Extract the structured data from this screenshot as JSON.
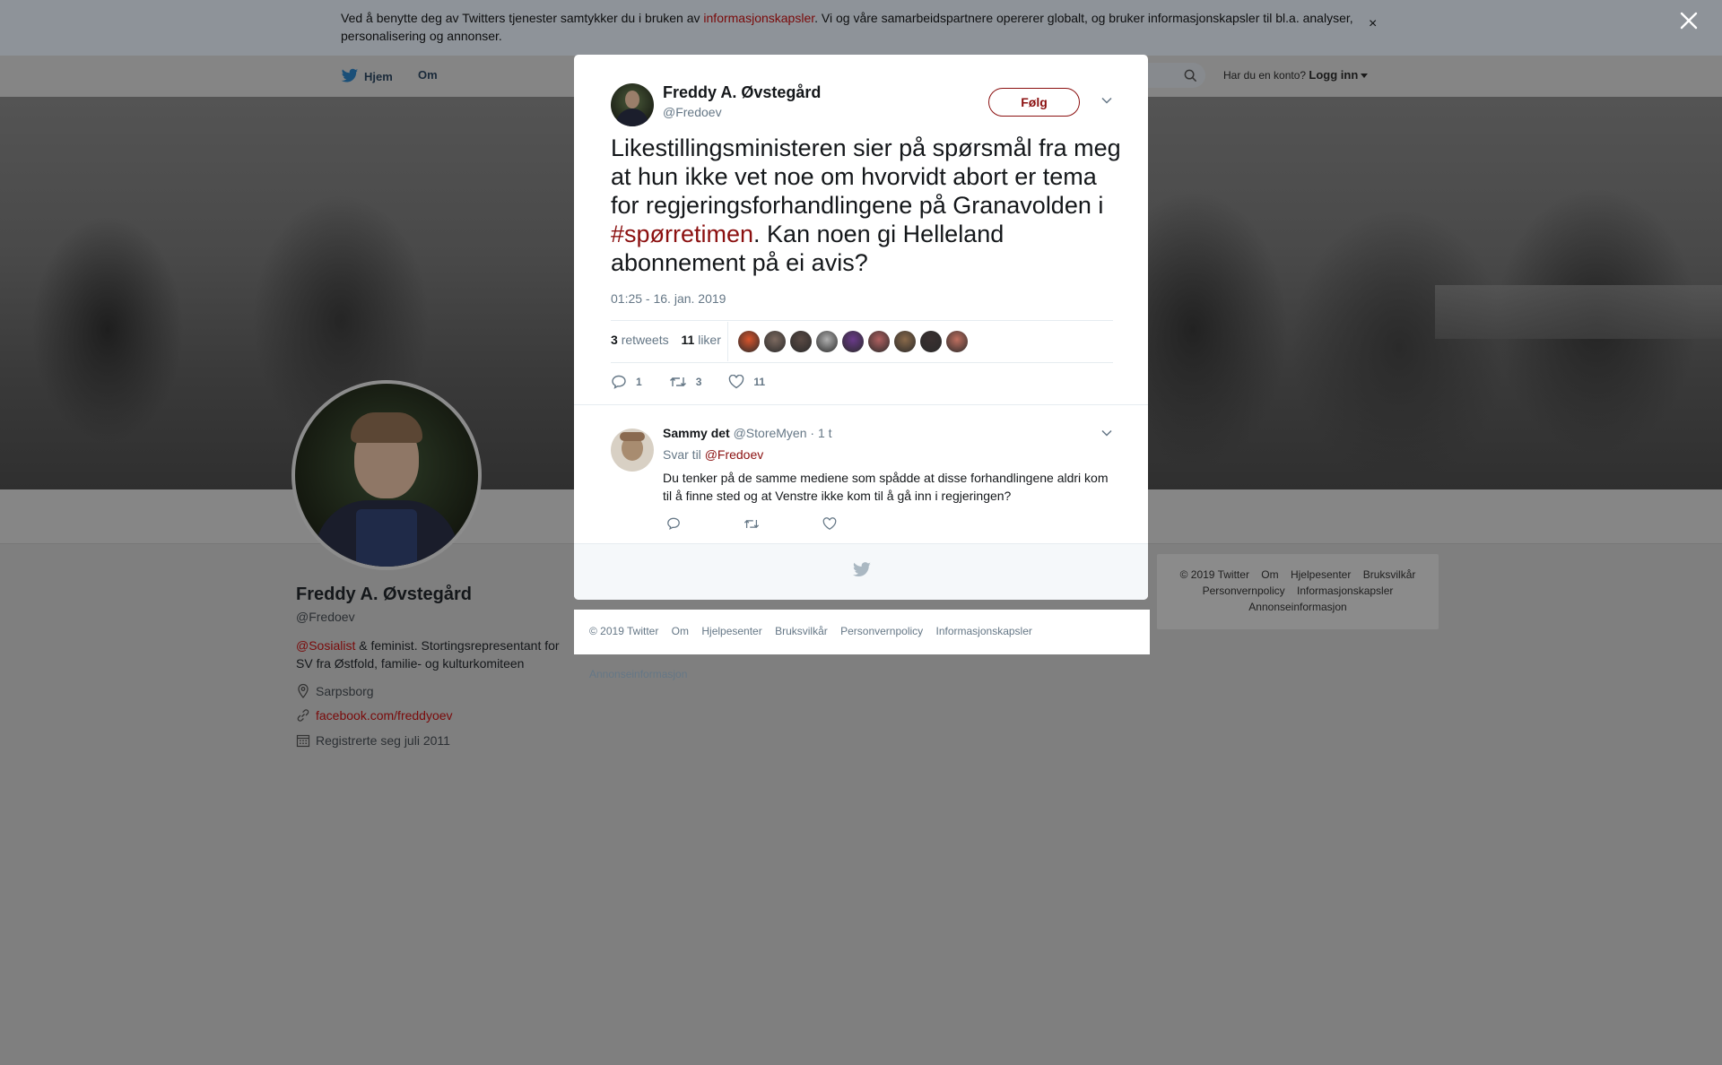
{
  "cookie_banner": {
    "text_before": "Ved å benytte deg av Twitters tjenester samtykker du i bruken av ",
    "link": "informasjonskapsler",
    "text_after": ". Vi og våre samarbeidspartnere opererer globalt, og bruker informasjonskapsler til bl.a. analyser, personalisering og annonser.",
    "close_symbol": "×"
  },
  "topnav": {
    "home": "Hjem",
    "about": "Om",
    "login_prompt": "Har du en konto?",
    "login": "Logg inn"
  },
  "profile": {
    "name": "Freddy A. Øvstegård",
    "handle": "@Fredoev",
    "bio_link": "@Sosialist",
    "bio_text": " & feminist. Stortingsrepresentant for SV fra Østfold, familie- og kulturkomiteen",
    "location": "Sarpsborg",
    "website": "facebook.com/freddyoev",
    "joined": "Registrerte seg juli 2011"
  },
  "side_footer": {
    "row1": [
      "© 2019 Twitter",
      "Om",
      "Hjelpesenter",
      "Bruksvilkår"
    ],
    "row2": [
      "Personvernpolicy",
      "Informasjonskapsler"
    ],
    "row3": [
      "Annonseinformasjon"
    ]
  },
  "tweet": {
    "author_name": "Freddy A. Øvstegård",
    "author_handle": "@Fredoev",
    "follow_label": "Følg",
    "text_before": "Likestillingsministeren sier på spørsmål fra meg at hun ikke vet noe om hvorvidt abort er tema for regjeringsforhandlingene på Granavolden i ",
    "hashtag": "#spørretimen",
    "text_after": ". Kan noen gi Helleland abonnement på ei avis?",
    "timestamp": "01:25 - 16. jan. 2019",
    "retweets_count": "3",
    "retweets_label": "retweets",
    "likes_count": "11",
    "likes_label": "liker",
    "reply_count": "1",
    "retweet_count": "3",
    "like_count": "11",
    "liker_colors": [
      "#d9542c",
      "#7d6a60",
      "#5a4a44",
      "#b0b0b0",
      "#6a3a8a",
      "#b06060",
      "#8a6a4a",
      "#3a3030",
      "#c07060"
    ]
  },
  "reply": {
    "name": "Sammy det",
    "handle": "@StoreMyen",
    "time": "· 1 t",
    "reply_to_label": "Svar til",
    "reply_to_handle": "@Fredoev",
    "text": "Du tenker på de samme mediene som spådde at disse forhandlingene aldri kom til å finne sted og at Venstre ikke kom til å gå inn i regjeringen?"
  },
  "modal_footer": [
    "© 2019 Twitter",
    "Om",
    "Hjelpesenter",
    "Bruksvilkår",
    "Personvernpolicy",
    "Informasjonskapsler",
    "Annonseinformasjon"
  ],
  "colors": {
    "accent": "#8b1010",
    "overlay": "#7f7f7f"
  }
}
